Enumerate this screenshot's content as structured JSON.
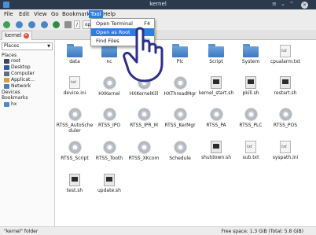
{
  "window": {
    "title": "kernel"
  },
  "menubar": {
    "items": [
      "File",
      "Edit",
      "View",
      "Go",
      "Bookmarks",
      "Tool",
      "Help"
    ]
  },
  "toolbar": {
    "path_button": "/",
    "path_segment": "opt"
  },
  "tab": {
    "label": "kernel"
  },
  "sidebar": {
    "selector": "Places",
    "section_places": "Places",
    "items": [
      "root",
      "Desktop",
      "Computer",
      "Applicat...",
      "Network"
    ],
    "section_devices": "Devices",
    "section_bookmarks": "Bookmarks",
    "bookmark_item": "hx"
  },
  "tool_menu": {
    "items": [
      {
        "label": "Open Terminal",
        "shortcut": "F4"
      },
      {
        "label": "Open as Root",
        "shortcut": ""
      },
      {
        "label": "Find Files",
        "shortcut": "F3"
      }
    ]
  },
  "files": [
    {
      "name": "data",
      "icon": "folder-icon"
    },
    {
      "name": "nc",
      "icon": "folder-icon"
    },
    {
      "name": "",
      "icon": "folder-icon"
    },
    {
      "name": "Plc",
      "icon": "folder-icon"
    },
    {
      "name": "Script",
      "icon": "folder-icon"
    },
    {
      "name": "System",
      "icon": "folder-icon"
    },
    {
      "name": "cpualarm.txt",
      "icon": "text-file-icon"
    },
    {
      "name": "device.ini",
      "icon": "text-file-icon"
    },
    {
      "name": "HXKernel",
      "icon": "gear-icon"
    },
    {
      "name": "HXKernelKill",
      "icon": "gear-icon"
    },
    {
      "name": "HXThreadMgr",
      "icon": "gear-icon"
    },
    {
      "name": "kernel_start.sh",
      "icon": "script-icon"
    },
    {
      "name": "pkill.sh",
      "icon": "script-icon"
    },
    {
      "name": "restart.sh",
      "icon": "script-icon"
    },
    {
      "name": "RTSS_AutoScheduler",
      "icon": "gear-icon"
    },
    {
      "name": "RTSS_IPO",
      "icon": "gear-icon"
    },
    {
      "name": "RTSS_IPR_M",
      "icon": "gear-icon"
    },
    {
      "name": "RTSS_KerMgr",
      "icon": "gear-icon"
    },
    {
      "name": "RTSS_PA",
      "icon": "gear-icon"
    },
    {
      "name": "RTSS_PLC",
      "icon": "gear-icon"
    },
    {
      "name": "RTSS_POS",
      "icon": "gear-icon"
    },
    {
      "name": "RTSS_Script",
      "icon": "gear-icon"
    },
    {
      "name": "RTSS_Tooth",
      "icon": "gear-icon"
    },
    {
      "name": "RTSS_XKcom",
      "icon": "gear-icon"
    },
    {
      "name": "Schedule",
      "icon": "gear-icon"
    },
    {
      "name": "shutdown.sh",
      "icon": "script-icon"
    },
    {
      "name": "sub.txt",
      "icon": "text-file-icon"
    },
    {
      "name": "syspath.ini",
      "icon": "text-file-icon"
    },
    {
      "name": "test.sh",
      "icon": "script-icon"
    },
    {
      "name": "update.sh",
      "icon": "script-icon"
    }
  ],
  "statusbar": {
    "left": "\"kernel\" folder",
    "right": "Free space: 1.3 GiB (Total: 5.8 GiB)"
  },
  "colors": {
    "accent": "#2e7de1",
    "titlebar": "#2b3a4c",
    "folder": "#4f8ad0"
  }
}
